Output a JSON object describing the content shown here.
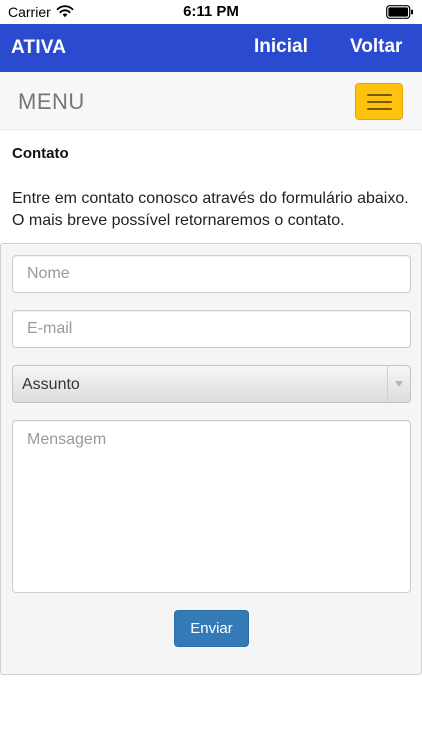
{
  "status_bar": {
    "carrier": "Carrier",
    "time": "6:11 PM",
    "icons": [
      "wifi-icon",
      "battery-icon"
    ]
  },
  "header": {
    "brand": "ATIVA",
    "nav": {
      "inicial": "Inicial",
      "voltar": "Voltar"
    },
    "background_color": "#2a4bd0"
  },
  "menu_bar": {
    "label": "MENU",
    "toggle_icon": "hamburger-icon",
    "toggle_color": "#ffc20e"
  },
  "content": {
    "title": "Contato",
    "intro": "Entre em contato conosco através do formulário abaixo. O mais breve possível retornaremos o contato."
  },
  "form": {
    "nome": {
      "placeholder": "Nome",
      "value": ""
    },
    "email": {
      "placeholder": "E-mail",
      "value": ""
    },
    "assunto": {
      "selected": "Assunto"
    },
    "mensagem": {
      "placeholder": "Mensagem",
      "value": ""
    },
    "submit_label": "Enviar",
    "submit_color": "#337ab7"
  }
}
